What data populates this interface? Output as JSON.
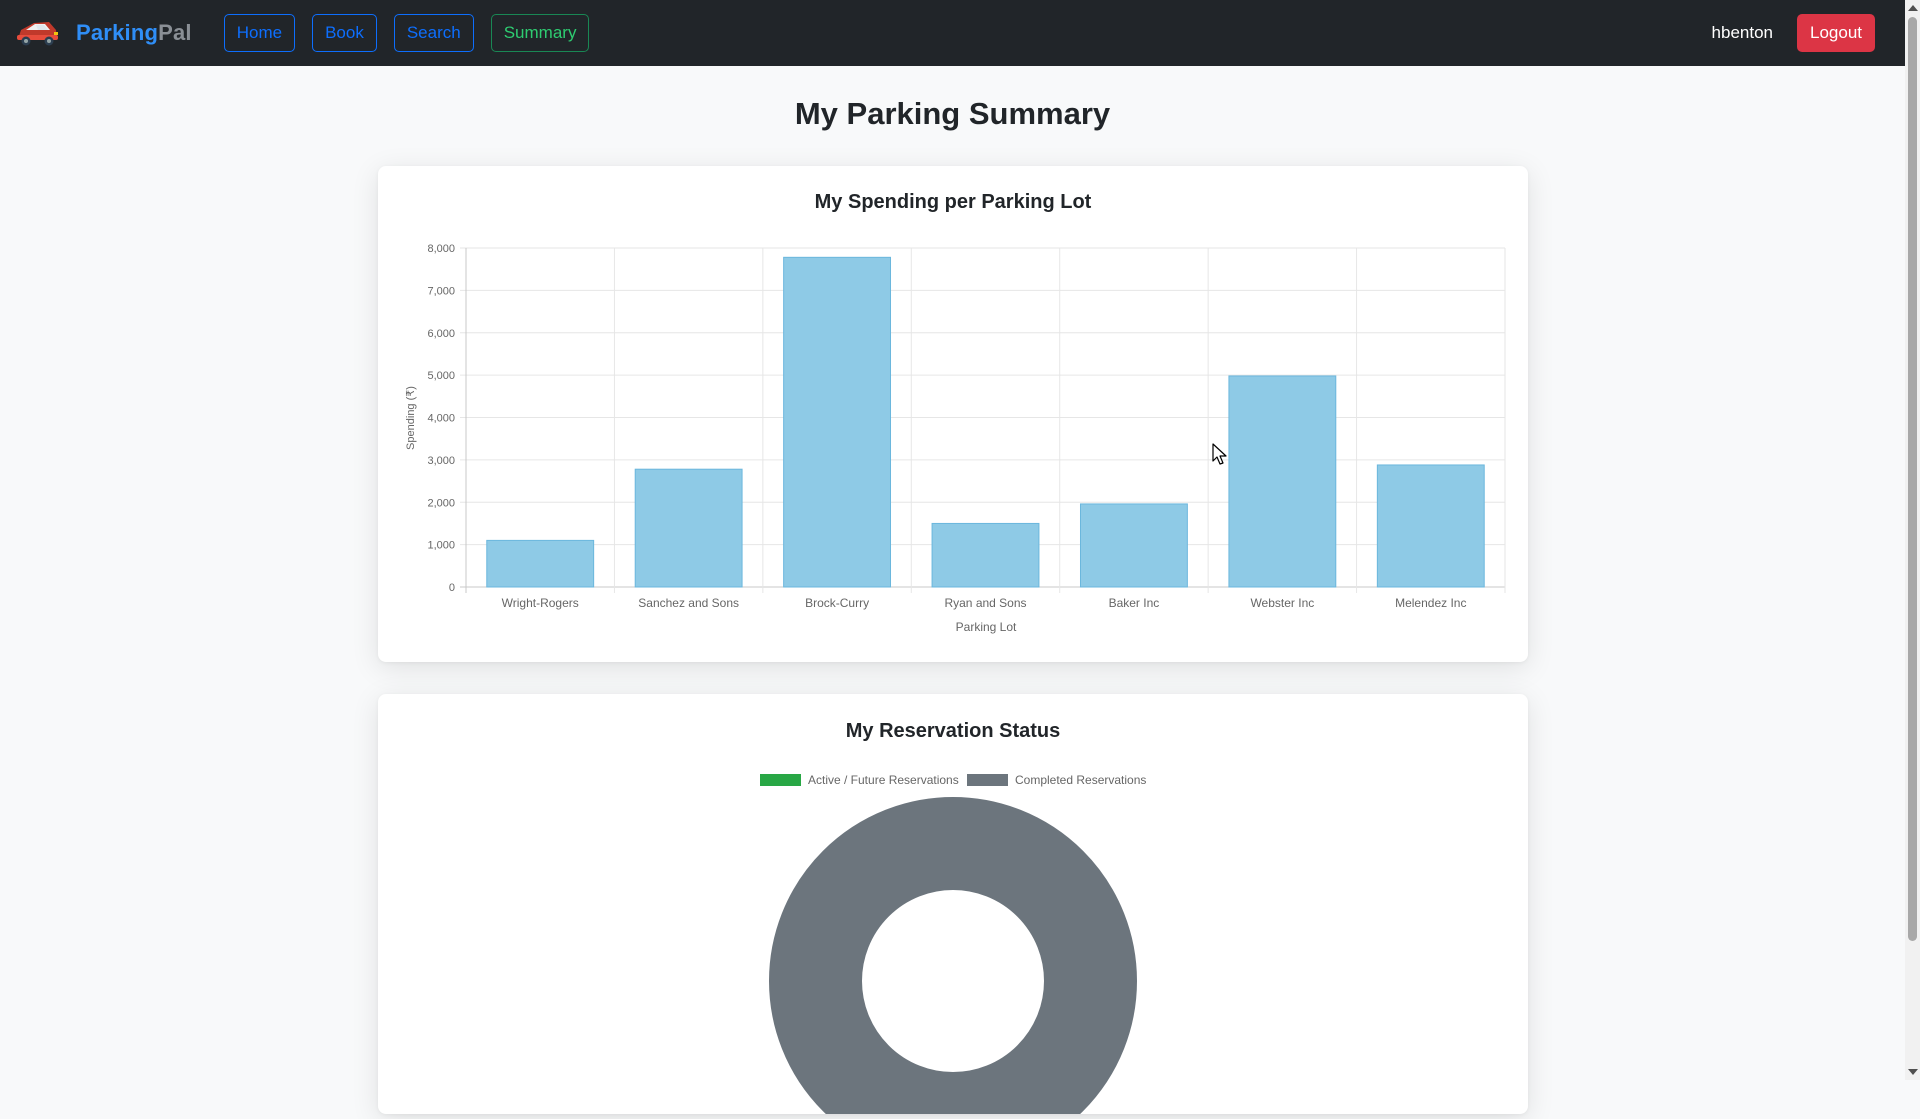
{
  "app": {
    "brand_part1": "Parking",
    "brand_part2": "Pal",
    "username": "hbenton",
    "logout_label": "Logout",
    "accent_color": "#0d6efd",
    "active_color": "#198754",
    "danger_color": "#dc3545"
  },
  "nav": {
    "items": [
      {
        "label": "Home",
        "active": false
      },
      {
        "label": "Book",
        "active": false
      },
      {
        "label": "Search",
        "active": false
      },
      {
        "label": "Summary",
        "active": true
      }
    ]
  },
  "page": {
    "title": "My Parking Summary"
  },
  "chart_data": [
    {
      "type": "bar",
      "title": "My Spending per Parking Lot",
      "xlabel": "Parking Lot",
      "ylabel": "Spending (₹)",
      "categories": [
        "Wright-Rogers",
        "Sanchez and Sons",
        "Brock-Curry",
        "Ryan and Sons",
        "Baker Inc",
        "Webster Inc",
        "Melendez Inc"
      ],
      "values": [
        1100,
        2780,
        7780,
        1500,
        1960,
        4980,
        2880
      ],
      "ylim": [
        0,
        8000
      ],
      "yticks": [
        0,
        1000,
        2000,
        3000,
        4000,
        5000,
        6000,
        7000,
        8000
      ],
      "ytick_labels": [
        "0",
        "1,000",
        "2,000",
        "3,000",
        "4,000",
        "5,000",
        "6,000",
        "7,000",
        "8,000"
      ],
      "bar_color": "#8ecae6",
      "bar_border_color": "#6bb7dd",
      "grid": true
    },
    {
      "type": "pie",
      "title": "My Reservation Status",
      "categories": [
        "Active / Future Reservations",
        "Completed Reservations"
      ],
      "values": [
        0,
        1
      ],
      "colors": [
        "#28a745",
        "#6c757d"
      ],
      "legend": "top",
      "donut": true
    }
  ]
}
